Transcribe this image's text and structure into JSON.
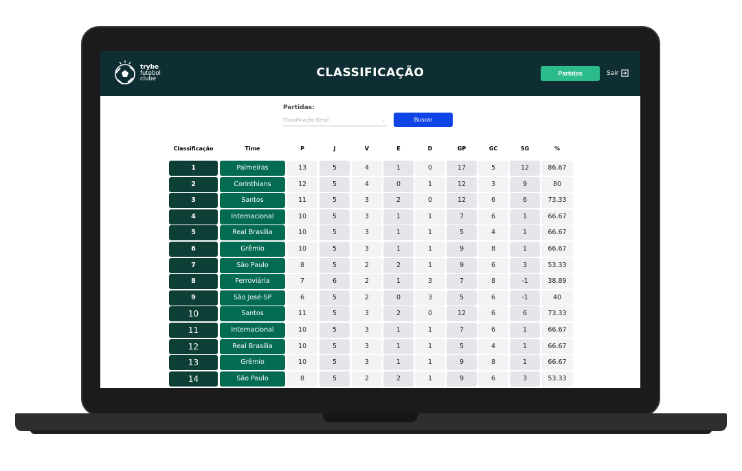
{
  "brand": {
    "line1": "trybe",
    "line2": "futebol",
    "line3": "clube"
  },
  "header": {
    "title": "CLASSIFICAÇÃO",
    "partidas_button": "Partidas",
    "logout": "Sair"
  },
  "filter": {
    "label": "Partidas:",
    "placeholder": "Classificação Geral",
    "search_button": "Buscar"
  },
  "table": {
    "headers": [
      "Classificação",
      "Time",
      "P",
      "J",
      "V",
      "E",
      "D",
      "GP",
      "GC",
      "SG",
      "%"
    ],
    "rows": [
      [
        "1",
        "Palmeiras",
        "13",
        "5",
        "4",
        "1",
        "0",
        "17",
        "5",
        "12",
        "86.67"
      ],
      [
        "2",
        "Corinthians",
        "12",
        "5",
        "4",
        "0",
        "1",
        "12",
        "3",
        "9",
        "80"
      ],
      [
        "3",
        "Santos",
        "11",
        "5",
        "3",
        "2",
        "0",
        "12",
        "6",
        "6",
        "73.33"
      ],
      [
        "4",
        "Internacional",
        "10",
        "5",
        "3",
        "1",
        "1",
        "7",
        "6",
        "1",
        "66.67"
      ],
      [
        "5",
        "Real Brasília",
        "10",
        "5",
        "3",
        "1",
        "1",
        "5",
        "4",
        "1",
        "66.67"
      ],
      [
        "6",
        "Grêmio",
        "10",
        "5",
        "3",
        "1",
        "1",
        "9",
        "8",
        "1",
        "66.67"
      ],
      [
        "7",
        "São Paulo",
        "8",
        "5",
        "2",
        "2",
        "1",
        "9",
        "6",
        "3",
        "53.33"
      ],
      [
        "8",
        "Ferroviária",
        "7",
        "6",
        "2",
        "1",
        "3",
        "7",
        "8",
        "-1",
        "38.89"
      ],
      [
        "9",
        "São José-SP",
        "6",
        "5",
        "2",
        "0",
        "3",
        "5",
        "6",
        "-1",
        "40"
      ],
      [
        "10",
        "Santos",
        "11",
        "5",
        "3",
        "2",
        "0",
        "12",
        "6",
        "6",
        "73.33"
      ],
      [
        "11",
        "Internacional",
        "10",
        "5",
        "3",
        "1",
        "1",
        "7",
        "6",
        "1",
        "66.67"
      ],
      [
        "12",
        "Real Brasília",
        "10",
        "5",
        "3",
        "1",
        "1",
        "5",
        "4",
        "1",
        "66.67"
      ],
      [
        "13",
        "Grêmio",
        "10",
        "5",
        "3",
        "1",
        "1",
        "9",
        "8",
        "1",
        "66.67"
      ],
      [
        "14",
        "São Paulo",
        "8",
        "5",
        "2",
        "2",
        "1",
        "9",
        "6",
        "3",
        "53.33"
      ]
    ]
  },
  "icons": {
    "logo": "soccer-ball-logo-icon",
    "logout": "logout-icon",
    "dropdown": "chevron-down-icon"
  },
  "colors": {
    "header_bg": "#0f2e33",
    "position_cell": "#0e3f36",
    "team_cell": "#036b52",
    "partidas_button": "#2cbb8a",
    "search_button": "#0f45e6"
  }
}
